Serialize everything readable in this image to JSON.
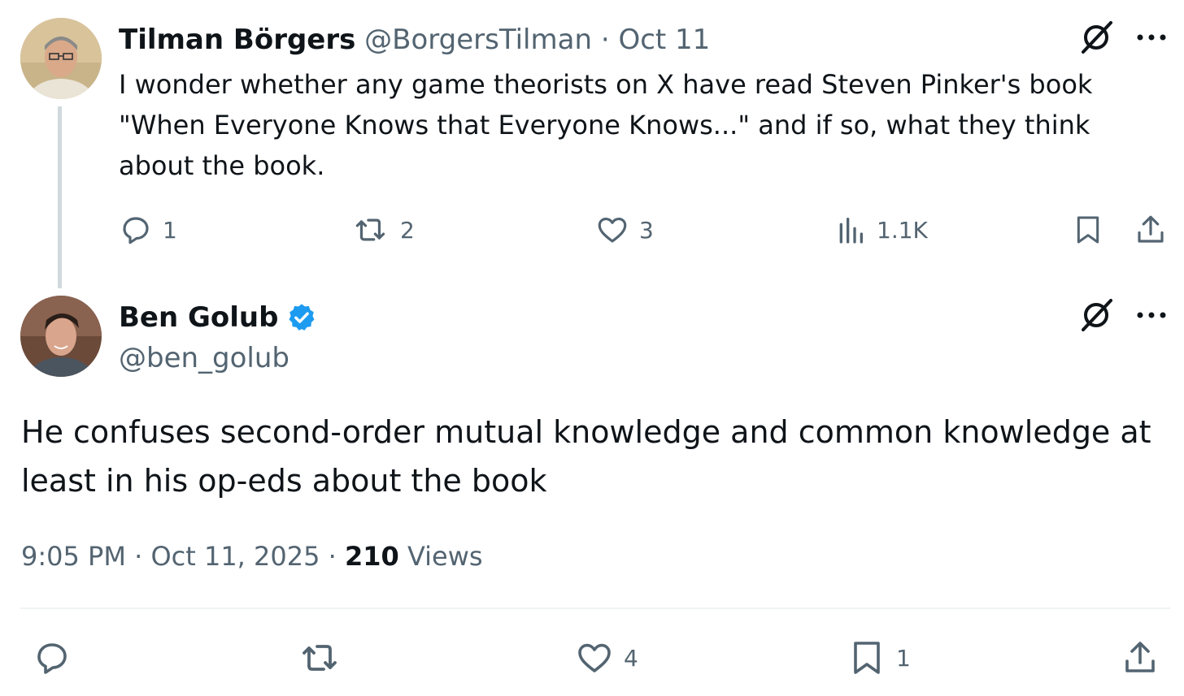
{
  "parent_tweet": {
    "author_name": "Tilman Börgers",
    "author_handle": "@BorgersTilman",
    "separator": "·",
    "date": "Oct 11",
    "text": "I wonder whether any game theorists on X have read Steven Pinker's book \"When Everyone Knows that Everyone Knows...\" and if so, what they think about the book.",
    "actions": {
      "replies": "1",
      "reposts": "2",
      "likes": "3",
      "views": "1.1K"
    }
  },
  "main_tweet": {
    "author_name": "Ben Golub",
    "author_handle": "@ben_golub",
    "verified": true,
    "text": "He confuses second-order mutual knowledge and common knowledge at least in his op-eds about the book",
    "time": "9:05 PM",
    "separator": "·",
    "date": "Oct 11, 2025",
    "view_count": "210",
    "views_label": "Views",
    "actions": {
      "replies": "",
      "reposts": "",
      "likes": "4",
      "bookmarks": "1"
    }
  },
  "colors": {
    "text": "#0f1419",
    "muted": "#536471",
    "verified": "#1d9bf0",
    "thread_line": "#cfd9de",
    "divider": "#eff3f4"
  },
  "icons": [
    "grok-icon",
    "more-icon",
    "reply-icon",
    "repost-icon",
    "like-icon",
    "views-icon",
    "bookmark-icon",
    "share-icon",
    "verified-badge-icon"
  ]
}
